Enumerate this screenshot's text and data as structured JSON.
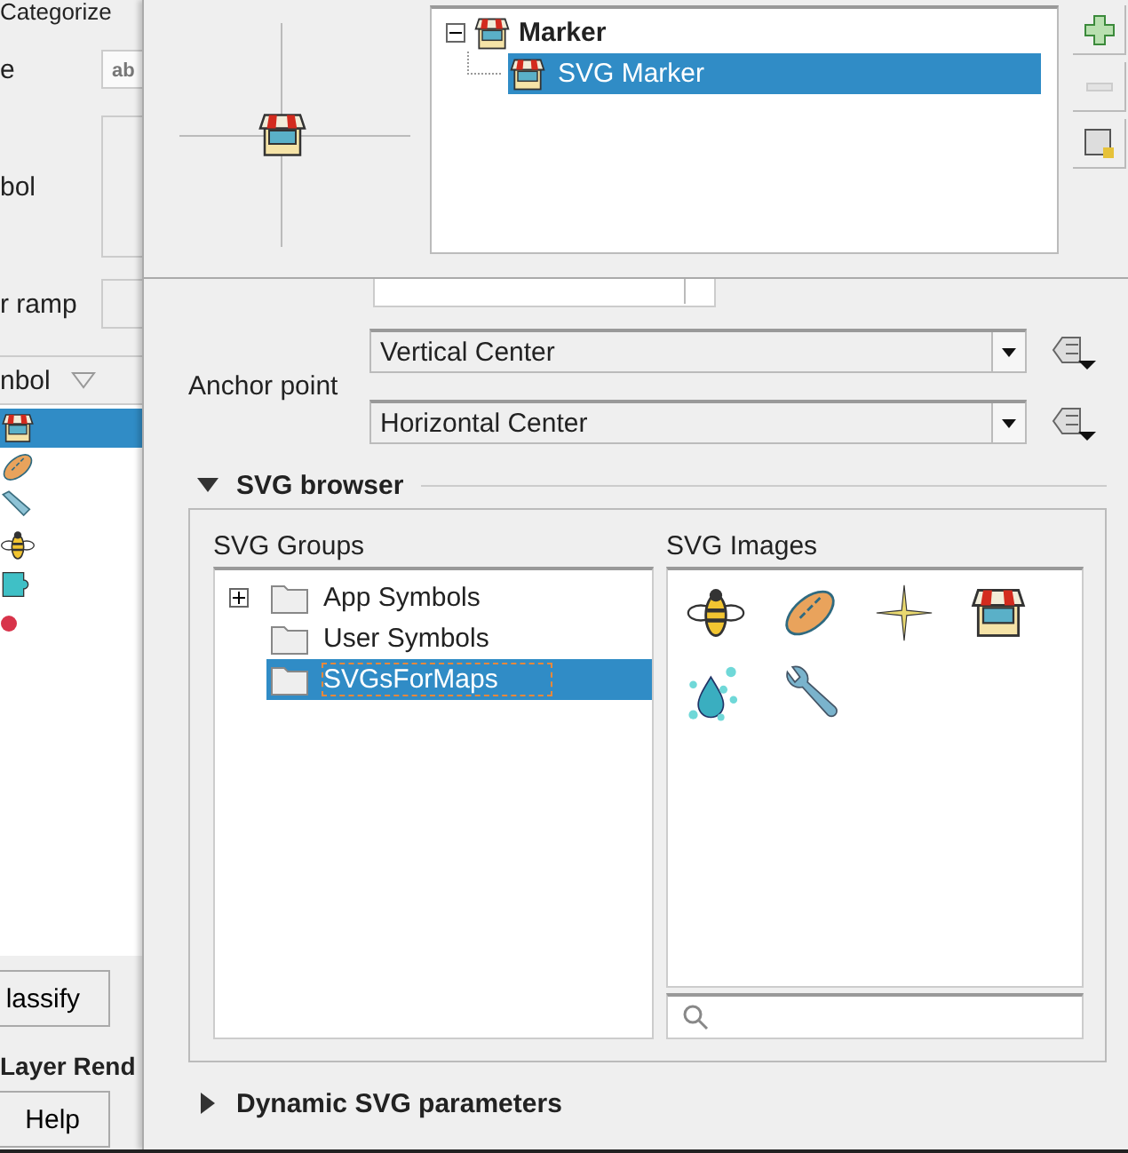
{
  "background_window": {
    "title": "Categorize",
    "fields": [
      {
        "label": "e",
        "value": "ab"
      },
      {
        "label": "bol"
      },
      {
        "label": "r ramp"
      }
    ],
    "column_header": "nbol",
    "symbols": [
      {
        "kind": "shop",
        "selected": true
      },
      {
        "kind": "bread",
        "selected": false
      },
      {
        "kind": "knife",
        "selected": false
      },
      {
        "kind": "bee",
        "selected": false
      },
      {
        "kind": "puzzle",
        "selected": false
      },
      {
        "kind": "dot",
        "selected": false
      }
    ],
    "classify_button": "lassify",
    "section_title": "Layer Rend",
    "help_button": "Help"
  },
  "symbol_layers": [
    {
      "label": "Marker",
      "expanded": true,
      "selected": false,
      "children": [
        {
          "label": "SVG Marker",
          "selected": true
        }
      ]
    }
  ],
  "layer_buttons": [
    {
      "kind": "add",
      "disabled": false
    },
    {
      "kind": "remove",
      "disabled": true
    },
    {
      "kind": "duplicate",
      "disabled": false
    }
  ],
  "anchor_point": {
    "label": "Anchor point",
    "vertical": "Vertical Center",
    "horizontal": "Horizontal Center"
  },
  "svg_browser": {
    "title": "SVG browser",
    "expanded": true,
    "groups_label": "SVG Groups",
    "groups": [
      {
        "label": "App Symbols",
        "expandable": true,
        "selected": false
      },
      {
        "label": "User Symbols",
        "expandable": false,
        "selected": false
      },
      {
        "label": "SVGsForMaps",
        "expandable": false,
        "selected": true
      }
    ],
    "images_label": "SVG Images",
    "images": [
      {
        "kind": "bee"
      },
      {
        "kind": "bread"
      },
      {
        "kind": "sparkle"
      },
      {
        "kind": "shop"
      },
      {
        "kind": "drop"
      },
      {
        "kind": "wrench"
      }
    ]
  },
  "dynamic_svg": {
    "title": "Dynamic SVG parameters",
    "expanded": false
  }
}
